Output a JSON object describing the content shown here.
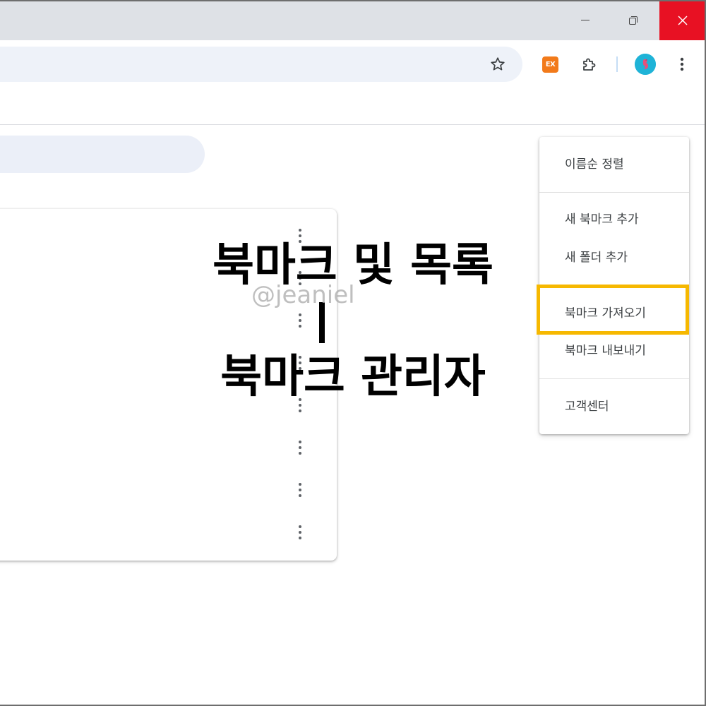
{
  "window": {
    "controls": {
      "minimize_icon": "minimize-icon",
      "restore_icon": "restore-icon",
      "close_icon": "close-icon"
    }
  },
  "toolbar": {
    "star_icon": "bookmark-star-icon",
    "extension_label": "EX",
    "extensions_icon": "puzzle-icon",
    "menu_icon": "kebab-menu-icon"
  },
  "overlay": {
    "line1": "북마크 및 목록",
    "line3": "북마크 관리자",
    "watermark": "@jeaniel"
  },
  "menu": {
    "items": [
      {
        "label": "이름순 정렬"
      },
      {
        "label": "새 북마크 추가"
      },
      {
        "label": "새 폴더 추가"
      },
      {
        "label": "북마크 가져오기"
      },
      {
        "label": "북마크 내보내기"
      },
      {
        "label": "고객센터"
      }
    ],
    "highlighted_index": 3
  },
  "colors": {
    "titlebar": "#dee1e6",
    "close_button": "#e81123",
    "highlight_border": "#f6b800",
    "extension_orange": "#f27a1a",
    "avatar": "#1fb3d7"
  }
}
